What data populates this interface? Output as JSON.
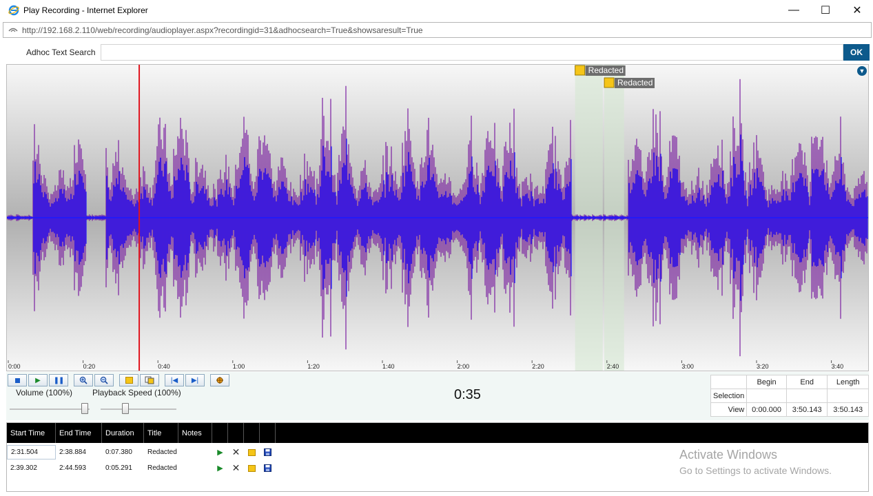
{
  "window": {
    "title": "Play Recording - Internet Explorer",
    "minimize": "—",
    "maximize": "☐",
    "close": "✕"
  },
  "address": {
    "url": "http://192.168.2.110/web/recording/audioplayer.aspx?recordingid=31&adhocsearch=True&showsaresult=True"
  },
  "search": {
    "label": "Adhoc Text Search",
    "value": "",
    "ok": "OK"
  },
  "waveform": {
    "duration_seconds": 230.143,
    "playhead_seconds": 35,
    "ticks": [
      "0:00",
      "0:20",
      "0:40",
      "1:00",
      "1:20",
      "1:40",
      "2:00",
      "2:20",
      "2:40",
      "3:00",
      "3:20",
      "3:40"
    ],
    "colors": {
      "wave": "#1a1aff",
      "wave_dim": "#7b1fa2",
      "playhead": "#e0141e",
      "region": "#d4e8d0",
      "marker_bg": "#6d6d6d"
    },
    "regions": [
      {
        "label": "Redacted",
        "start_seconds": 151.504,
        "end_seconds": 158.884
      },
      {
        "label": "Redacted",
        "start_seconds": 159.302,
        "end_seconds": 164.593
      }
    ]
  },
  "controls": {
    "volume_label": "Volume (100%)",
    "volume_value": 100,
    "speed_label": "Playback Speed (100%)",
    "speed_value": 100,
    "current_time": "0:35"
  },
  "selection": {
    "headers": [
      "Begin",
      "End",
      "Length"
    ],
    "row_selection": "Selection",
    "row_view": "View",
    "view_begin": "0:00.000",
    "view_end": "3:50.143",
    "view_length": "3:50.143"
  },
  "segments": {
    "columns": [
      "Start Time",
      "End Time",
      "Duration",
      "Title",
      "Notes"
    ],
    "rows": [
      {
        "start": "2:31.504",
        "end": "2:38.884",
        "duration": "0:07.380",
        "title": "Redacted",
        "notes": ""
      },
      {
        "start": "2:39.302",
        "end": "2:44.593",
        "duration": "0:05.291",
        "title": "Redacted",
        "notes": ""
      }
    ]
  },
  "watermark": {
    "line1": "Activate Windows",
    "line2": "Go to Settings to activate Windows."
  }
}
